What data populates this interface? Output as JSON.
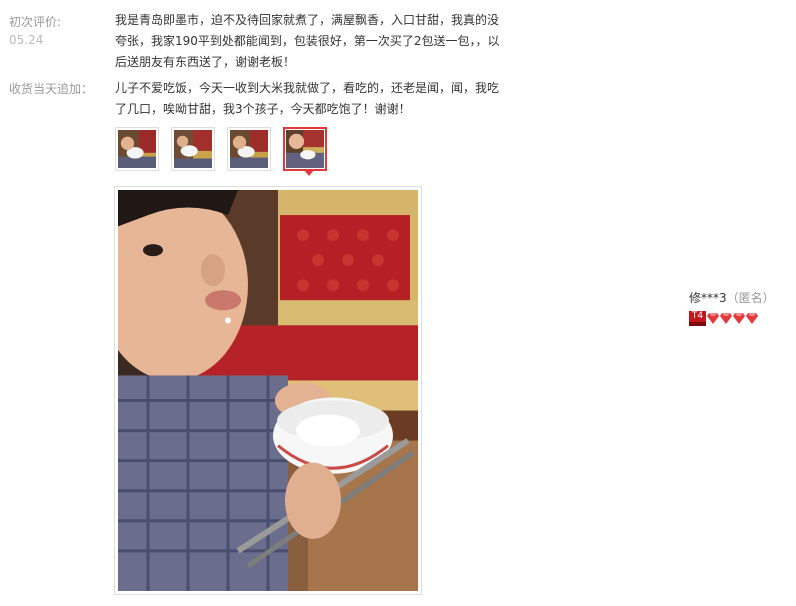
{
  "initial_review": {
    "label": "初次评价:",
    "date": "05.24",
    "text_lines": [
      "我是青岛即墨市，迫不及待回家就煮了，满屋飘香，入口甘甜，我真的没",
      "夸张，我家190平到处都能闻到，包装很好，第一次买了2包送一包，，以",
      "后送朋友有东西送了，谢谢老板！"
    ]
  },
  "append_review": {
    "label": "收货当天追加：",
    "text_lines": [
      "儿子不爱吃饭，今天一收到大米我就做了，看吃的，还老是闻，闻，我吃",
      "了几口，唉呦甘甜，我3个孩子，今天都吃饱了！谢谢！"
    ]
  },
  "thumbnails": {
    "count": 4,
    "selected_index": 3
  },
  "reviewer": {
    "name": "修***3",
    "anonymous_tag": "（匿名）",
    "level_badge": "T4",
    "gem_count": 4
  },
  "colors": {
    "accent": "#e4393c",
    "badge_red": "#c4161c",
    "label_gray": "#999999",
    "text": "#333333",
    "border": "#dddddd"
  }
}
